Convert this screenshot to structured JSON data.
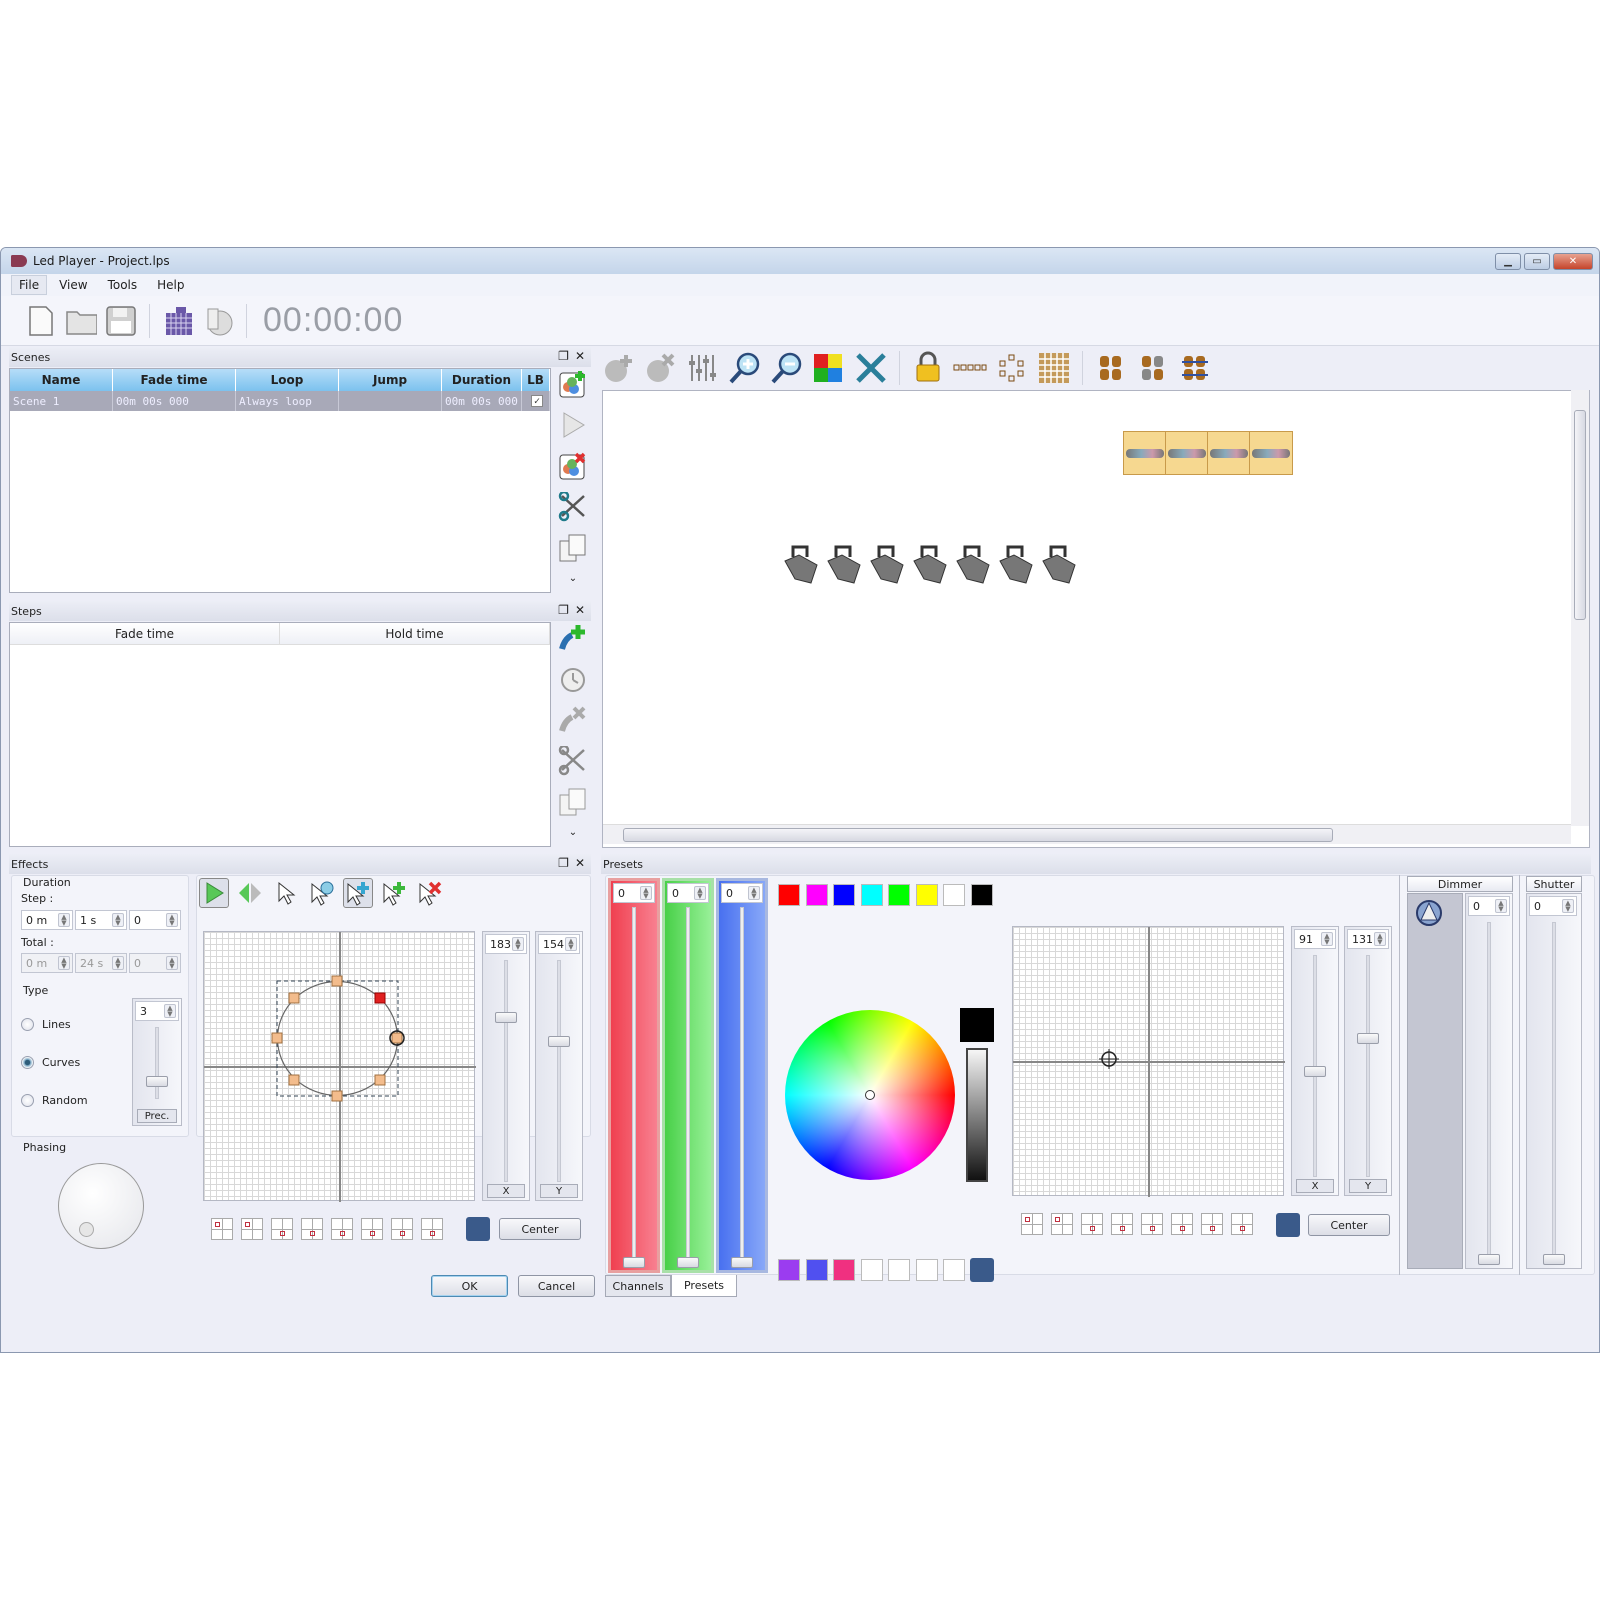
{
  "window": {
    "title": "Led Player - Project.lps",
    "controls": [
      "minimize",
      "maximize",
      "close"
    ]
  },
  "menu": [
    "File",
    "View",
    "Tools",
    "Help"
  ],
  "toolbar": {
    "icons": [
      "new-file-icon",
      "open-folder-icon",
      "save-icon",
      "matrix-icon",
      "import-icon"
    ],
    "timer": "00:00:00"
  },
  "scenes": {
    "title": "Scenes",
    "columns": [
      "Name",
      "Fade time",
      "Loop",
      "Jump",
      "Duration",
      "LB"
    ],
    "rows": [
      {
        "name": "Scene 1",
        "fade": "00m 00s 000",
        "loop": "Always loop",
        "jump": "",
        "duration": "00m 00s 000",
        "lb": true
      }
    ],
    "side_tools": [
      "add-scene-icon",
      "play-icon",
      "delete-scene-icon",
      "cut-icon",
      "copy-icon",
      "more-icon"
    ]
  },
  "steps": {
    "title": "Steps",
    "columns": [
      "Fade time",
      "Hold time"
    ],
    "side_tools": [
      "add-step-icon",
      "timer-icon",
      "delete-step-icon",
      "cut-icon",
      "copy-icon",
      "more-icon"
    ]
  },
  "canvas_toolbar": [
    "add-fixture-icon",
    "remove-fixture-icon",
    "mixer-icon",
    "zoom-in-icon",
    "zoom-out-icon",
    "color-grid-icon",
    "tools-icon",
    "lock-icon",
    "line-layout-icon",
    "circle-layout-icon",
    "matrix-layout-icon",
    "group-a-icon",
    "group-b-icon",
    "group-link-icon"
  ],
  "stage": {
    "led_bars": 4,
    "par_cans": 7
  },
  "effects": {
    "title": "Effects",
    "duration_label": "Duration",
    "step_label": "Step :",
    "step": {
      "min": "0 m",
      "sec": "1 s",
      "ms": "0"
    },
    "total_label": "Total :",
    "total": {
      "min": "0 m",
      "sec": "24 s",
      "ms": "0"
    },
    "type_label": "Type",
    "types": [
      {
        "label": "Lines",
        "selected": false
      },
      {
        "label": "Curves",
        "selected": true
      },
      {
        "label": "Random",
        "selected": false
      }
    ],
    "precision": "3",
    "precision_label": "Prec.",
    "phasing_label": "Phasing",
    "x_value": "183",
    "y_value": "154",
    "x_label": "X",
    "y_label": "Y",
    "center_label": "Center",
    "ok_label": "OK",
    "cancel_label": "Cancel",
    "tools": [
      "play-icon",
      "step-icon",
      "pointer-icon",
      "rotate-pointer-icon",
      "move-pointer-icon",
      "add-point-icon",
      "delete-point-icon"
    ]
  },
  "presets": {
    "title": "Presets",
    "rgb": {
      "r": "0",
      "g": "0",
      "b": "0"
    },
    "colors": [
      "#ff0000",
      "#ff00ff",
      "#0000ff",
      "#00ffff",
      "#00ff00",
      "#ffff00",
      "#ffffff",
      "#000000"
    ],
    "custom_colors": [
      "#9b3cf0",
      "#5050f0",
      "#f03080",
      "#ffffff",
      "#ffffff",
      "#ffffff",
      "#ffffff"
    ],
    "pan_value": "91",
    "tilt_value": "131",
    "x_label": "X",
    "y_label": "Y",
    "center_label": "Center",
    "dimmer_label": "Dimmer",
    "dimmer_value": "0",
    "shutter_label": "Shutter",
    "shutter_value": "0",
    "tabs": [
      "Channels",
      "Presets"
    ],
    "active_tab": "Presets"
  }
}
